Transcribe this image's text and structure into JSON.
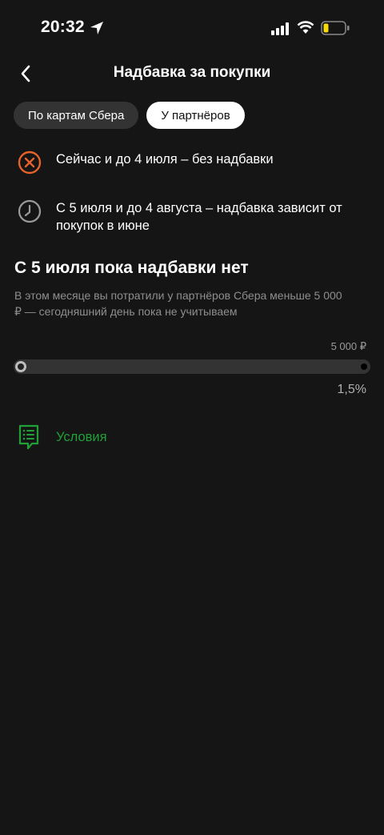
{
  "status_bar": {
    "time": "20:32"
  },
  "header": {
    "title": "Надбавка за покупки"
  },
  "tabs": [
    {
      "label": "По картам Сбера",
      "active": false
    },
    {
      "label": "У партнёров",
      "active": true
    }
  ],
  "info_rows": [
    {
      "icon": "cancel-circle-icon",
      "text": "Сейчас и до 4 июля – без надбавки"
    },
    {
      "icon": "clock-icon",
      "text": "С 5 июля и до 4 августа – надбавка зависит от покупок в июне"
    }
  ],
  "section": {
    "title": "С 5 июля пока надбавки нет",
    "description": "В этом месяце вы потратили у партнёров Сбера меньше 5 000 ₽ — сегодняшний день пока не учитываем"
  },
  "progress": {
    "limit_label": "5 000 ₽",
    "rate_label": "1,5%",
    "fraction": 0
  },
  "conditions": {
    "label": "Условия",
    "icon": "document-list-icon"
  },
  "colors": {
    "background": "#151515",
    "accent_green": "#21a038",
    "cancel_orange": "#e5632b"
  }
}
